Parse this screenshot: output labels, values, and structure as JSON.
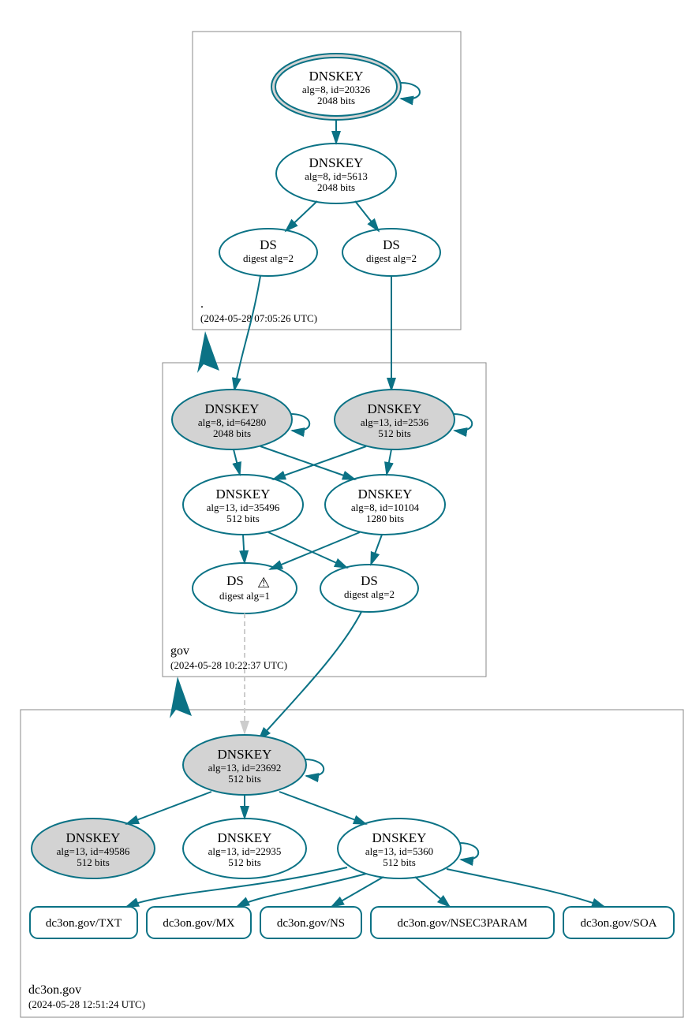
{
  "zones": {
    "root": {
      "name": ".",
      "timestamp": "(2024-05-28 07:05:26 UTC)"
    },
    "gov": {
      "name": "gov",
      "timestamp": "(2024-05-28 10:22:37 UTC)"
    },
    "leaf": {
      "name": "dc3on.gov",
      "timestamp": "(2024-05-28 12:51:24 UTC)"
    }
  },
  "nodes": {
    "root_ksk": {
      "title": "DNSKEY",
      "line2": "alg=8, id=20326",
      "line3": "2048 bits"
    },
    "root_zsk": {
      "title": "DNSKEY",
      "line2": "alg=8, id=5613",
      "line3": "2048 bits"
    },
    "root_ds1": {
      "title": "DS",
      "line2": "digest alg=2"
    },
    "root_ds2": {
      "title": "DS",
      "line2": "digest alg=2"
    },
    "gov_k1": {
      "title": "DNSKEY",
      "line2": "alg=8, id=64280",
      "line3": "2048 bits"
    },
    "gov_k2": {
      "title": "DNSKEY",
      "line2": "alg=13, id=2536",
      "line3": "512 bits"
    },
    "gov_k3": {
      "title": "DNSKEY",
      "line2": "alg=13, id=35496",
      "line3": "512 bits"
    },
    "gov_k4": {
      "title": "DNSKEY",
      "line2": "alg=8, id=10104",
      "line3": "1280 bits"
    },
    "gov_ds1": {
      "title": "DS",
      "line2": "digest alg=1",
      "warn": "⚠"
    },
    "gov_ds2": {
      "title": "DS",
      "line2": "digest alg=2"
    },
    "leaf_ksk": {
      "title": "DNSKEY",
      "line2": "alg=13, id=23692",
      "line3": "512 bits"
    },
    "leaf_k1": {
      "title": "DNSKEY",
      "line2": "alg=13, id=49586",
      "line3": "512 bits"
    },
    "leaf_k2": {
      "title": "DNSKEY",
      "line2": "alg=13, id=22935",
      "line3": "512 bits"
    },
    "leaf_k3": {
      "title": "DNSKEY",
      "line2": "alg=13, id=5360",
      "line3": "512 bits"
    }
  },
  "records": {
    "txt": "dc3on.gov/TXT",
    "mx": "dc3on.gov/MX",
    "ns": "dc3on.gov/NS",
    "nsec3param": "dc3on.gov/NSEC3PARAM",
    "soa": "dc3on.gov/SOA"
  }
}
